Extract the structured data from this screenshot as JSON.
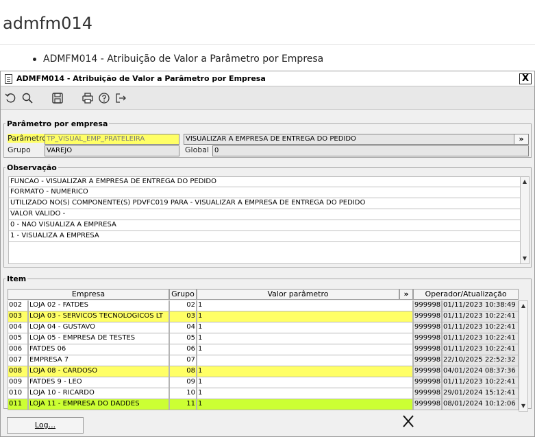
{
  "page": {
    "heading": "admfm014",
    "bullet": "ADMFM014 - Atribuição de Valor a Parâmetro por Empresa"
  },
  "window": {
    "title": "ADMFM014 - Atribuição de Valor a Parâmetro por Empresa",
    "close_label": "X",
    "toolbar_icons": [
      "undo-icon",
      "search-icon",
      "save-icon",
      "print-icon",
      "help-icon",
      "exit-icon"
    ]
  },
  "param_group": {
    "legend": "Parâmetro por empresa",
    "parametro_label": "Parâmetro",
    "parametro_value": "TP_VISUAL_EMP_PRATELEIRA",
    "descricao_value": "VISUALIZAR A EMPRESA DE ENTREGA DO PEDIDO",
    "more_label": "»",
    "grupo_label": "Grupo",
    "grupo_value": "VAREJO",
    "global_label": "Global",
    "global_value": "0"
  },
  "observacao": {
    "legend": "Observação",
    "lines": [
      "FUNCAO - VISUALIZAR A EMPRESA DE ENTREGA DO PEDIDO",
      "FORMATO - NUMERICO",
      "UTILIZADO NO(S) COMPONENTE(S) PDVFC019  PARA  - VISUALIZAR A EMPRESA DE ENTREGA DO PEDIDO",
      "VALOR VALIDO -",
      " 0 - NAO VISUALIZA A EMPRESA",
      " 1 - VISUALIZA A EMPRESA"
    ]
  },
  "item": {
    "legend": "Item",
    "headers": {
      "empresa": "Empresa",
      "grupo": "Grupo",
      "valor": "Valor parâmetro",
      "more": "»",
      "operador": "Operador/Atualização"
    },
    "rows": [
      {
        "code": "002",
        "empresa": "LOJA 02 - FATDES",
        "grupo": "02",
        "valor": "1",
        "operador": "999998",
        "data": "01/11/2023 10:38:49",
        "hl": ""
      },
      {
        "code": "003",
        "empresa": "LOJA 03 - SERVICOS TECNOLOGICOS LT",
        "grupo": "03",
        "valor": "1",
        "operador": "999998",
        "data": "01/11/2023 10:22:41",
        "hl": "yellow"
      },
      {
        "code": "004",
        "empresa": "LOJA 04 - GUSTAVO",
        "grupo": "04",
        "valor": "1",
        "operador": "999998",
        "data": "01/11/2023 10:22:41",
        "hl": ""
      },
      {
        "code": "005",
        "empresa": "LOJA 05 - EMPRESA DE TESTES",
        "grupo": "05",
        "valor": "1",
        "operador": "999998",
        "data": "01/11/2023 10:22:41",
        "hl": ""
      },
      {
        "code": "006",
        "empresa": "FATDES 06",
        "grupo": "06",
        "valor": "1",
        "operador": "999998",
        "data": "01/11/2023 10:22:41",
        "hl": ""
      },
      {
        "code": "007",
        "empresa": "EMPRESA 7",
        "grupo": "07",
        "valor": "",
        "operador": "999998",
        "data": "22/10/2025 22:52:32",
        "hl": ""
      },
      {
        "code": "008",
        "empresa": "LOJA 08 - CARDOSO",
        "grupo": "08",
        "valor": "1",
        "operador": "999998",
        "data": "04/01/2024 08:37:36",
        "hl": "yellow"
      },
      {
        "code": "009",
        "empresa": "FATDES 9 - LEO",
        "grupo": "09",
        "valor": "1",
        "operador": "999998",
        "data": "01/11/2023 10:22:41",
        "hl": ""
      },
      {
        "code": "010",
        "empresa": "LOJA 10 - RICARDO",
        "grupo": "10",
        "valor": "1",
        "operador": "999998",
        "data": "29/01/2024 15:12:41",
        "hl": ""
      },
      {
        "code": "011",
        "empresa": "LOJA 11 - EMPRESA DO DADDES",
        "grupo": "11",
        "valor": "1",
        "operador": "999998",
        "data": "08/01/2024 10:12:06",
        "hl": "green"
      }
    ]
  },
  "footer": {
    "log_label": "Log..."
  },
  "colors": {
    "highlight_yellow": "#ffff66",
    "highlight_green": "#ccff33",
    "window_bg": "#f0f0f0"
  }
}
